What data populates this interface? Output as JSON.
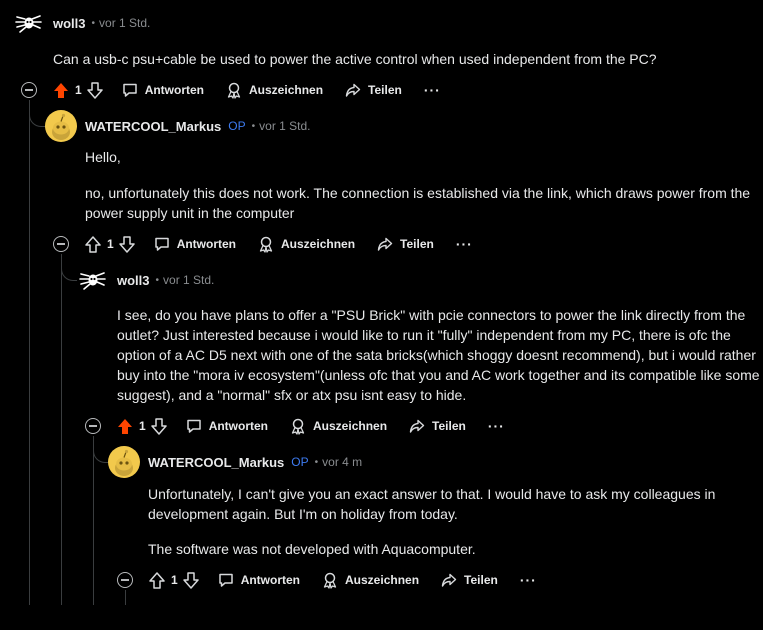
{
  "comments": [
    {
      "author": "woll3",
      "op_badge": "",
      "time": "vor 1 Std.",
      "paragraphs": [
        "Can a usb-c psu+cable be used to power the active control when used independent from the PC?"
      ],
      "score": "1",
      "upvoted": true
    },
    {
      "author": "WATERCOOL_Markus",
      "op_badge": "OP",
      "time": "vor 1 Std.",
      "paragraphs": [
        "Hello,",
        "no, unfortunately this does not work. The connection is established via the link, which draws power from the power supply unit in the computer"
      ],
      "score": "1",
      "upvoted": false
    },
    {
      "author": "woll3",
      "op_badge": "",
      "time": "vor 1 Std.",
      "paragraphs": [
        "I see, do you have plans to offer a \"PSU Brick\" with pcie connectors to power the link directly from the outlet? Just interested because i would like to run it \"fully\" independent from my PC, there is ofc the option of a AC D5 next with one of the sata bricks(which shoggy doesnt recommend), but i would rather buy into the \"mora iv ecosystem\"(unless ofc that you and AC work together and its compatible like some suggest), and a \"normal\" sfx or atx psu isnt easy to hide."
      ],
      "score": "1",
      "upvoted": true
    },
    {
      "author": "WATERCOOL_Markus",
      "op_badge": "OP",
      "time": "vor 4 m",
      "paragraphs": [
        "Unfortunately, I can't give you an exact answer to that. I would have to ask my colleagues in development again. But I'm on holiday from today.",
        "The software was not developed with Aquacomputer."
      ],
      "score": "1",
      "upvoted": false
    }
  ],
  "labels": {
    "reply": "Antworten",
    "award": "Auszeichnen",
    "share": "Teilen",
    "more": "···",
    "dot": "•"
  },
  "colors": {
    "upvote_active": "#ff4500",
    "op_badge": "#3d7bf0",
    "avatar_yellow": "#f2c94c"
  }
}
